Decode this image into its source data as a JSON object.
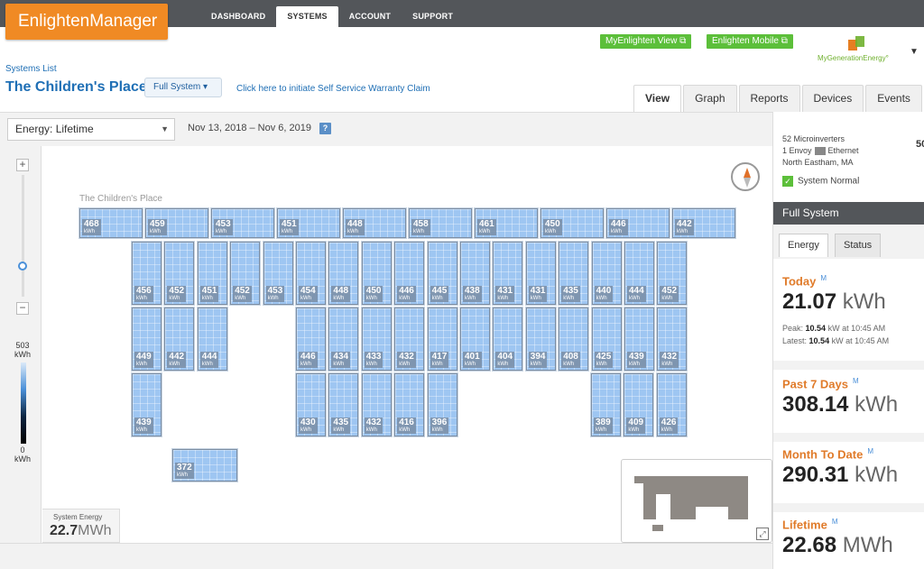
{
  "header": {
    "logo": "EnlightenManager",
    "nav": [
      "DASHBOARD",
      "SYSTEMS",
      "ACCOUNT",
      "SUPPORT"
    ],
    "myenlighten": "MyEnlighten View ⧉",
    "mobile": "Enlighten Mobile ⧉",
    "partner": "MyGenerationEnergy°"
  },
  "breadcrumb": "Systems List",
  "system_title": "The Children's Place",
  "full_system_btn": "Full System ▾",
  "warranty_link": "Click here to initiate Self Service Warranty Claim",
  "tabs": [
    "View",
    "Graph",
    "Reports",
    "Devices",
    "Events"
  ],
  "toolbar": {
    "energy_select": "Energy: Lifetime",
    "date_range": "Nov 13, 2018 – Nov 6, 2019",
    "help": "?"
  },
  "legend": {
    "max": "503",
    "min": "0",
    "unit": "kWh"
  },
  "array_label": "The Children's Place",
  "panel_unit": "kWh",
  "panels": {
    "row1": [
      468,
      459,
      453,
      451,
      448,
      458,
      461,
      450,
      446,
      442
    ],
    "row2": [
      456,
      452,
      451,
      452,
      453,
      454,
      448,
      450,
      446,
      445,
      438,
      431,
      431,
      435,
      440,
      444,
      452
    ],
    "row3_left": [
      449,
      442,
      444
    ],
    "row3_right": [
      446,
      434,
      433,
      432,
      417,
      401,
      404,
      394,
      408,
      425,
      439,
      432
    ],
    "row4_left": [
      439
    ],
    "row4_mid": [
      430,
      435,
      432,
      416,
      396
    ],
    "row4_right": [
      389,
      409,
      426
    ],
    "row5": [
      372
    ]
  },
  "system_energy": {
    "label": "System Energy",
    "value": "22.7",
    "unit": "MWh"
  },
  "right": {
    "microinverters": "52 Microinverters",
    "envoy": "1 Envoy",
    "ethernet": "Ethernet",
    "location": "North Eastham, MA",
    "cut_value": "50",
    "status": "System Normal",
    "panel_title": "Full System",
    "tab_energy": "Energy",
    "tab_status": "Status",
    "today": {
      "title": "Today",
      "marker": "M",
      "value": "21.07",
      "unit": "kWh",
      "peak_label": "Peak:",
      "peak_value": "10.54",
      "peak_unit": "kW at 10:45 AM",
      "latest_label": "Latest:",
      "latest_value": "10.54",
      "latest_unit": "kW at 10:45 AM"
    },
    "past7": {
      "title": "Past 7 Days",
      "marker": "M",
      "value": "308.14",
      "unit": "kWh"
    },
    "month": {
      "title": "Month To Date",
      "marker": "M",
      "value": "290.31",
      "unit": "kWh"
    },
    "lifetime": {
      "title": "Lifetime",
      "marker": "M",
      "value": "22.68",
      "unit": "MWh"
    }
  },
  "colors": {
    "accent": "#f08a24",
    "link": "#1f6fb5",
    "panel": "#9ec6f2",
    "header": "#53565a",
    "green": "#5cbf3a"
  }
}
